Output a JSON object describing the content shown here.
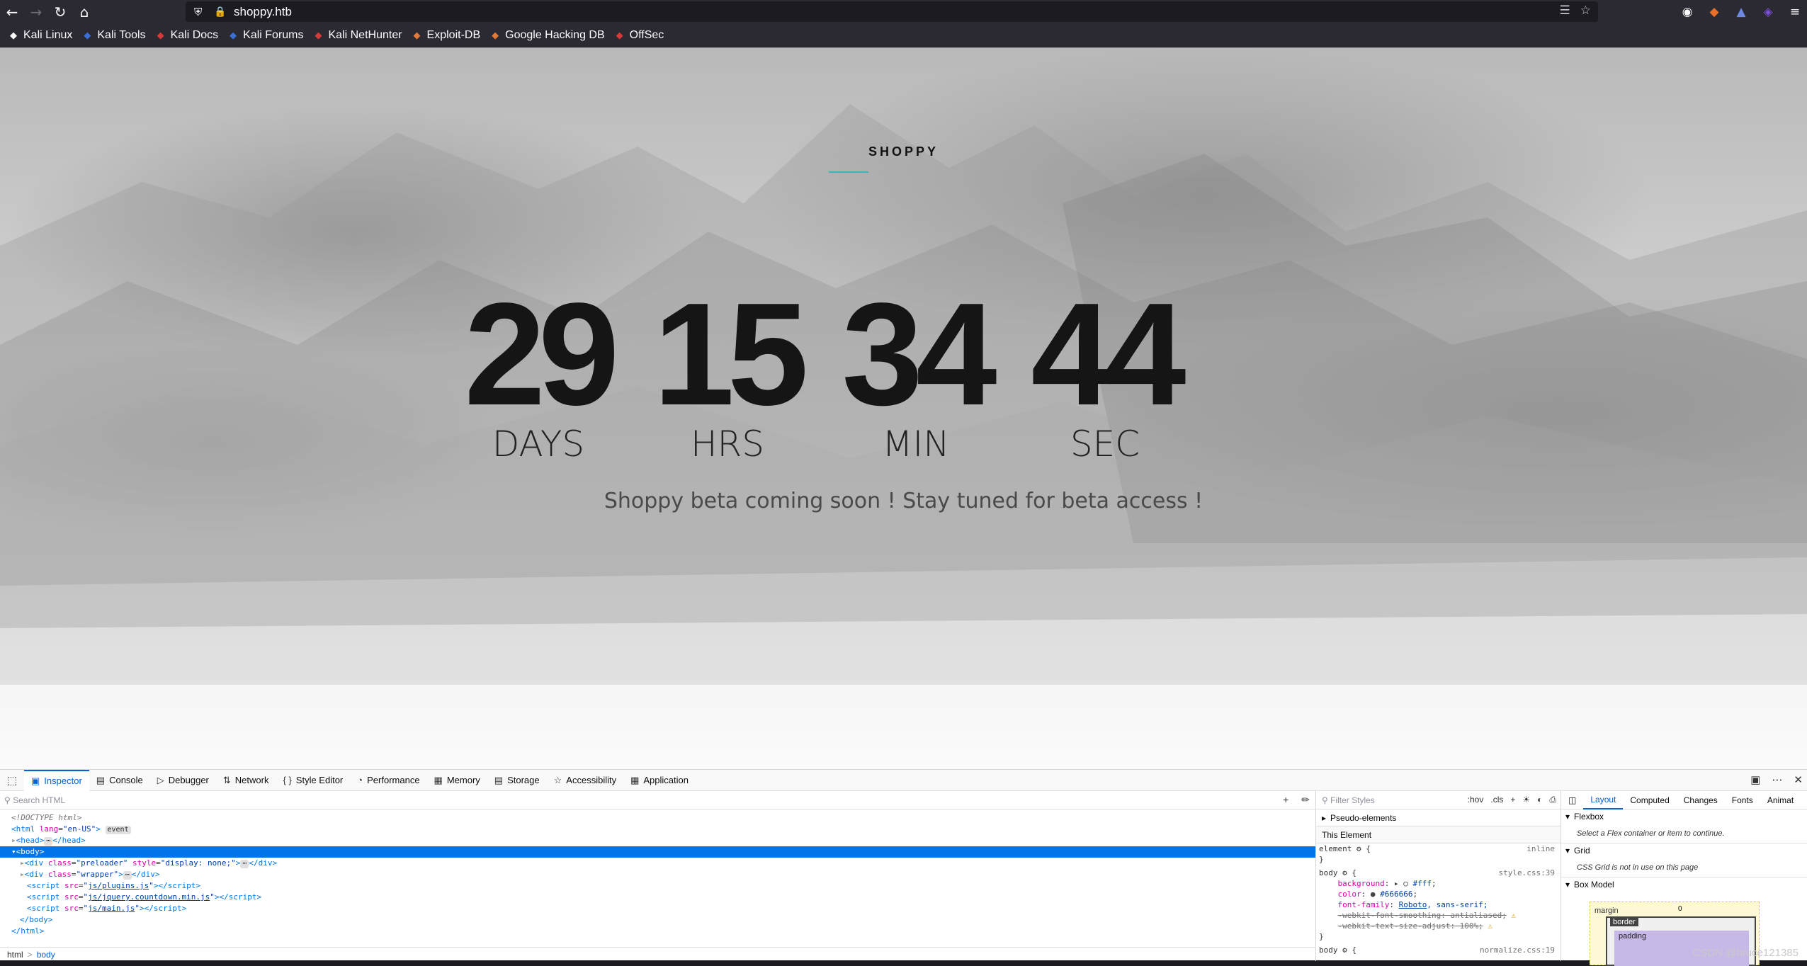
{
  "browser": {
    "url": "shoppy.htb",
    "bookmarks": [
      {
        "label": "Kali Linux",
        "icon": "kali-dragon-icon",
        "color": "#ffffff"
      },
      {
        "label": "Kali Tools",
        "icon": "kali-tools-icon",
        "color": "#3b6fd6"
      },
      {
        "label": "Kali Docs",
        "icon": "kali-docs-icon",
        "color": "#d63b3b"
      },
      {
        "label": "Kali Forums",
        "icon": "kali-forums-icon",
        "color": "#3b6fd6"
      },
      {
        "label": "Kali NetHunter",
        "icon": "nethunter-icon",
        "color": "#d63b3b"
      },
      {
        "label": "Exploit-DB",
        "icon": "exploit-db-icon",
        "color": "#e07a3a"
      },
      {
        "label": "Google Hacking DB",
        "icon": "ghdb-icon",
        "color": "#e07a3a"
      },
      {
        "label": "OffSec",
        "icon": "offsec-icon",
        "color": "#d63b3b"
      }
    ]
  },
  "page": {
    "logo": "SHOPPY",
    "accent_color": "#3fb2b7",
    "countdown": [
      {
        "value": "29",
        "label": "DAYS"
      },
      {
        "value": "15",
        "label": "HRS"
      },
      {
        "value": "34",
        "label": "MIN"
      },
      {
        "value": "44",
        "label": "SEC"
      }
    ],
    "tagline": "Shoppy beta coming soon ! Stay tuned for beta access !"
  },
  "devtools": {
    "tabs": [
      {
        "label": "Inspector",
        "icon": "inspector-icon",
        "active": true
      },
      {
        "label": "Console",
        "icon": "console-icon"
      },
      {
        "label": "Debugger",
        "icon": "debugger-icon"
      },
      {
        "label": "Network",
        "icon": "network-icon"
      },
      {
        "label": "Style Editor",
        "icon": "style-editor-icon"
      },
      {
        "label": "Performance",
        "icon": "performance-icon"
      },
      {
        "label": "Memory",
        "icon": "memory-icon"
      },
      {
        "label": "Storage",
        "icon": "storage-icon"
      },
      {
        "label": "Accessibility",
        "icon": "accessibility-icon"
      },
      {
        "label": "Application",
        "icon": "application-icon"
      }
    ],
    "search_placeholder": "Search HTML",
    "tree": {
      "doctype": "<!DOCTYPE html>",
      "html_lang": "en-US",
      "event_badge": "event",
      "preloader_class": "preloader",
      "preloader_style": "display: none;",
      "wrapper_class": "wrapper",
      "script1": "js/plugins.js",
      "script2": "js/jquery.countdown.min.js",
      "script3": "js/main.js"
    },
    "breadcrumbs": {
      "first": "html",
      "current": "body"
    },
    "rules": {
      "filter_placeholder": "Filter Styles",
      "hov": ":hov",
      "cls": ".cls",
      "pseudo": "Pseudo-elements",
      "this_element": "This Element",
      "element_rule": "element",
      "inline": "inline",
      "source1": "style.css:39",
      "source2": "normalize.css:19",
      "background": "#fff",
      "color": "#666666",
      "font_family_name": "Roboto",
      "font_family_rest": ", sans-serif;",
      "smoothing": "-webkit-font-smoothing: antialiased;",
      "text_size_adjust": "-webkit-text-size-adjust: 100%;"
    },
    "layout": {
      "tabs": [
        "Layout",
        "Computed",
        "Changes",
        "Fonts",
        "Animat"
      ],
      "flexbox": "Flexbox",
      "flexbox_note": "Select a Flex container or item to continue.",
      "grid": "Grid",
      "grid_note": "CSS Grid is not in use on this page",
      "box_model": "Box Model",
      "margin_label": "margin",
      "margin_value": "0",
      "border_label": "border",
      "padding_label": "padding"
    }
  },
  "watermark": "CSDN @bruce121385"
}
